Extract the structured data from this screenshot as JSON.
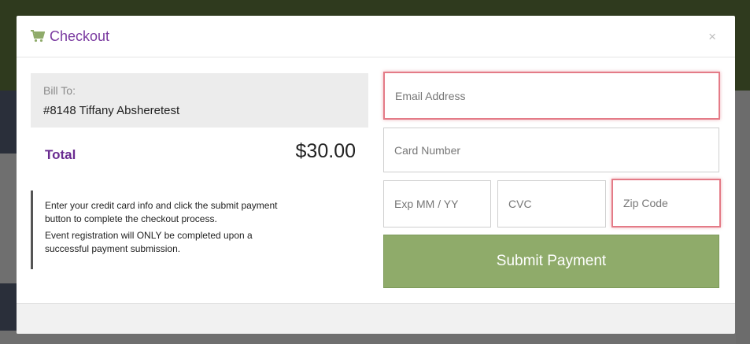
{
  "modal": {
    "title": "Checkout",
    "close_label": "×",
    "bill_to": {
      "label": "Bill To:",
      "name": "#8148 Tiffany Absheretest"
    },
    "total": {
      "label": "Total",
      "amount": "$30.00"
    },
    "info": {
      "line1": "Enter your credit card info and click the submit payment",
      "line2": "button to complete the checkout process.",
      "line3": "Event registration will ONLY be completed upon a",
      "line4": "successful payment submission."
    },
    "form": {
      "email_placeholder": "Email Address",
      "card_placeholder": "Card Number",
      "exp_placeholder": "Exp MM / YY",
      "cvc_placeholder": "CVC",
      "zip_placeholder": "Zip Code",
      "submit_label": "Submit Payment"
    }
  },
  "colors": {
    "title": "#7a3aa0",
    "total_label": "#6a2c91",
    "submit_bg": "#8fab6a",
    "error_border": "#e47b87",
    "cart_icon": "#8fab6a"
  },
  "icons": {
    "cart": "shopping-cart-icon",
    "close": "close-icon"
  }
}
